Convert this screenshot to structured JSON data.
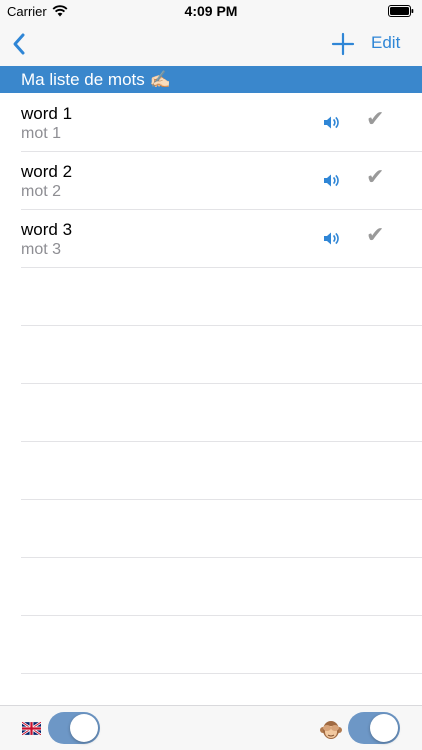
{
  "status_bar": {
    "carrier": "Carrier",
    "time": "4:09 PM"
  },
  "nav": {
    "back_icon": "chevron-left-icon",
    "add_icon": "plus-icon",
    "edit_label": "Edit",
    "accent_color": "#2f86d6"
  },
  "section": {
    "title": "Ma liste de mots ✍🏻",
    "background_color": "#3a87cc"
  },
  "words": [
    {
      "word": "word 1",
      "translation": "mot 1"
    },
    {
      "word": "word 2",
      "translation": "mot 2"
    },
    {
      "word": "word 3",
      "translation": "mot 3"
    }
  ],
  "toolbar": {
    "left_icon": "uk-flag-icon",
    "left_toggle_on": true,
    "right_icon": "see-no-evil-monkey-icon",
    "right_toggle_on": true
  }
}
